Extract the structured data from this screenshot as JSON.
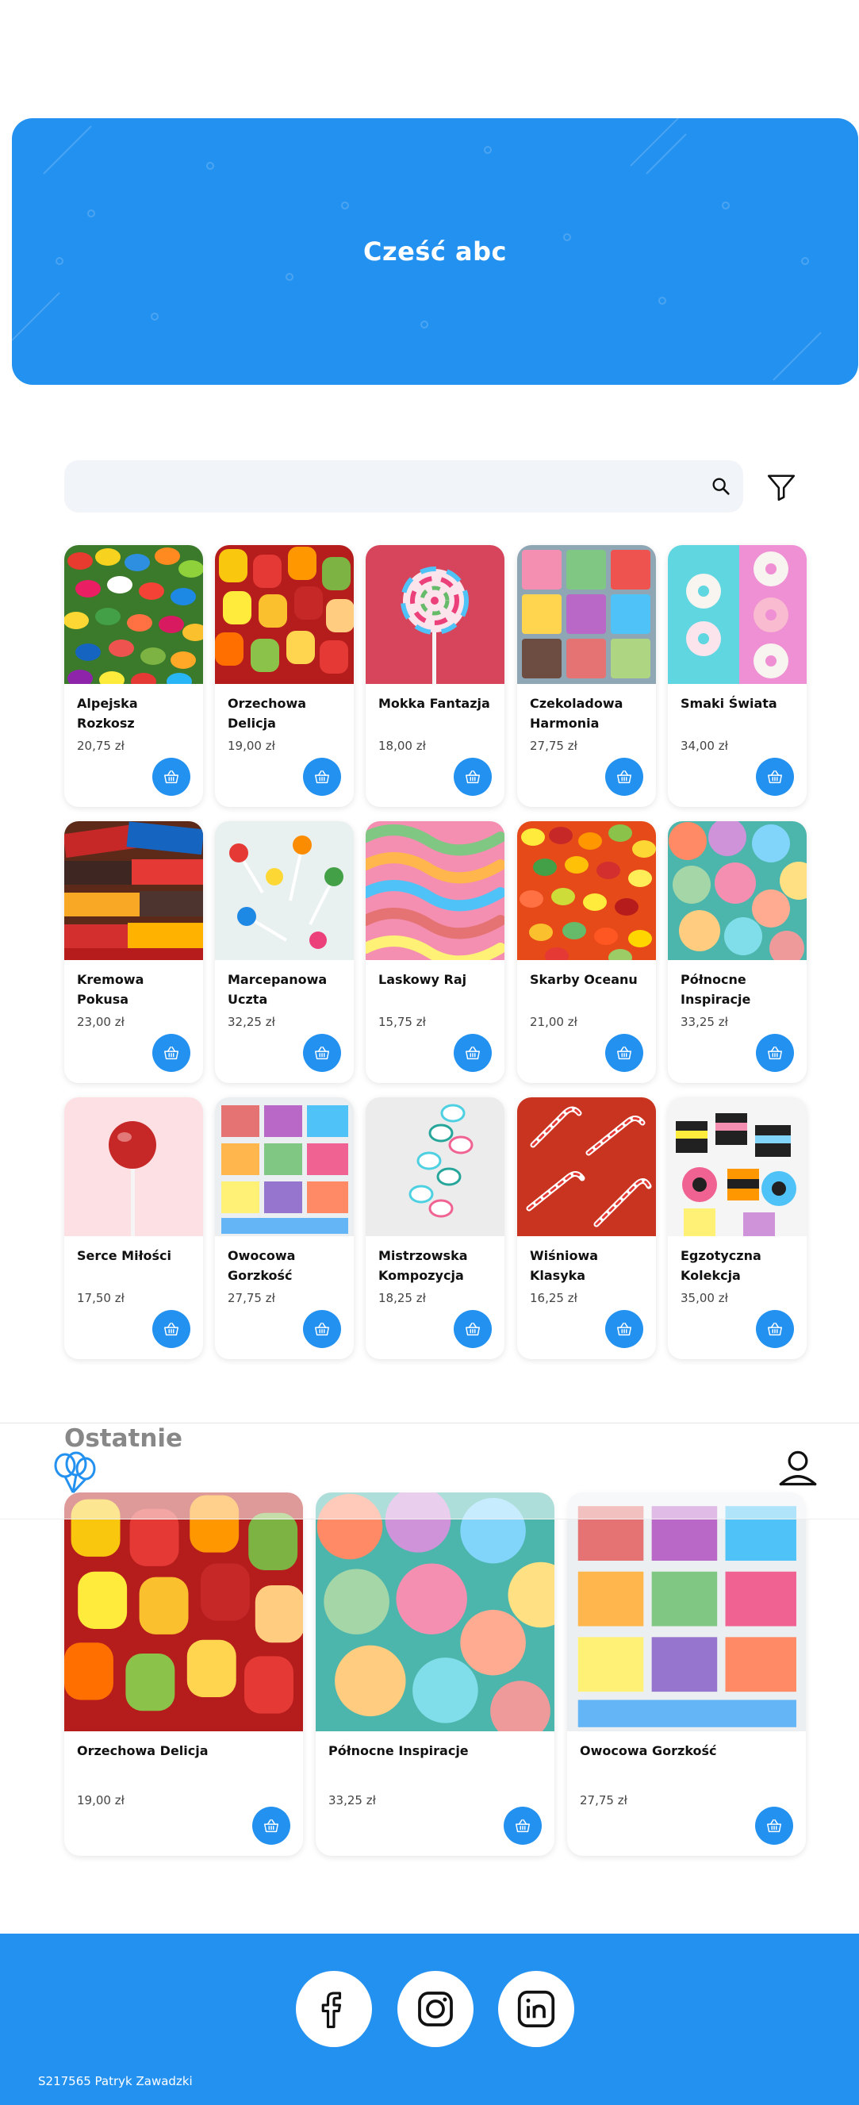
{
  "hero": {
    "title": "Cześć abc"
  },
  "search": {
    "placeholder": "",
    "value": ""
  },
  "icons": {
    "search": "search-icon",
    "filter": "filter-icon",
    "cart": "basket-icon",
    "logo": "balloons-icon",
    "user": "user-icon"
  },
  "colors": {
    "accent": "#2391f0",
    "search_bg": "#f1f4f8"
  },
  "products": [
    {
      "name": "Alpejska Rozkosz",
      "price": "20,75 zł"
    },
    {
      "name": "Orzechowa Delicja",
      "price": "19,00 zł"
    },
    {
      "name": "Mokka Fantazja",
      "price": "18,00 zł"
    },
    {
      "name": "Czekoladowa Harmonia",
      "price": "27,75 zł"
    },
    {
      "name": "Smaki Świata",
      "price": "34,00 zł"
    },
    {
      "name": "Kremowa Pokusa",
      "price": "23,00 zł"
    },
    {
      "name": "Marcepanowa Uczta",
      "price": "32,25 zł"
    },
    {
      "name": "Laskowy Raj",
      "price": "15,75 zł"
    },
    {
      "name": "Skarby Oceanu",
      "price": "21,00 zł"
    },
    {
      "name": "Północne Inspiracje",
      "price": "33,25 zł"
    },
    {
      "name": "Serce Miłości",
      "price": "17,50 zł"
    },
    {
      "name": "Owocowa Gorzkość",
      "price": "27,75 zł"
    },
    {
      "name": "Mistrzowska Kompozycja",
      "price": "18,25 zł"
    },
    {
      "name": "Wiśniowa Klasyka",
      "price": "16,25 zł"
    },
    {
      "name": "Egzotyczna Kolekcja",
      "price": "35,00 zł"
    }
  ],
  "recent": {
    "title": "Ostatnie",
    "items": [
      {
        "name": "Orzechowa Delicja",
        "price": "19,00 zł"
      },
      {
        "name": "Północne Inspiracje",
        "price": "33,25 zł"
      },
      {
        "name": "Owocowa Gorzkość",
        "price": "27,75 zł"
      }
    ]
  },
  "footer": {
    "social": [
      "facebook-icon",
      "instagram-icon",
      "linkedin-icon"
    ],
    "copyright": "S217565 Patryk Zawadzki"
  }
}
